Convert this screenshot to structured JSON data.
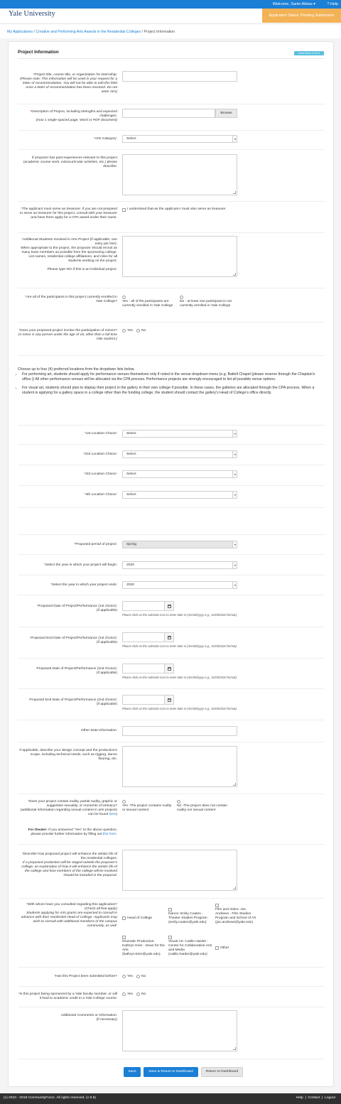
{
  "header": {
    "logo": "Yale University",
    "welcome": "Welcome, Sarim Abbas ▾",
    "help": "? Help",
    "status": "Application Status: Pending Submission"
  },
  "breadcrumb": {
    "item1": "My Applications",
    "sep": " / ",
    "item2": "Creative and Performing Arts Awards in the Residential Colleges",
    "item3": "Project Information"
  },
  "section": {
    "title": "Project Information",
    "autosave": "Auto Save in 6:13"
  },
  "fields": {
    "project_title": {
      "label": "Project title, course title, or organization for internship:",
      "note": "(Please note: This information will be used in your request for a letter of recommendation. You will not be able to edit this field once a letter of recommendation has been received. Do not enter N/A)"
    },
    "description": {
      "label": "Description of Project, including strengths and expected challenges.",
      "note": "(max 1 single-spaced page, Word or PDF document)",
      "browse": "Browse"
    },
    "arts_category": {
      "label": "Arts Category:",
      "value": "Select"
    },
    "past_experience": {
      "label": "If proposer has past experiences relevant to this project (academic course work, extracurricular activities, etc.) please describe:"
    },
    "treasurer": {
      "label": "The applicant must serve as treasurer. If you are not prepared to serve as treasurer for this project, consult with your treasurer and have them apply for a CPA award under their name.",
      "option": "I understand that-as the applicant-I must also serve as treasurer"
    },
    "additional_students": {
      "label": "Additional Students Involved in Arts Project (if applicable; one entry per line):",
      "detail": "When appropriate to the project, the proposer should recruit as many team members as possible from the sponsoring college.  List names, residential college affiliations, and roles for all students working on the project.",
      "na": "Please type N/A if this is an individual project."
    },
    "enrolled": {
      "label": "Are all of the participants in this project currently enrolled in Yale College?",
      "yes": "Yes - all of the participants are currently enrolled in Yale College",
      "no": "No - at least one participant is not currently enrolled in Yale College"
    },
    "minors": {
      "label": "Does your proposed project involve the participation of minors?",
      "note": "(A minor is any person under the age of 18, other than a full time Yale student.)",
      "yes": "Yes",
      "no": "No"
    }
  },
  "locations": {
    "intro": "Choose up to four (4) preferred locations from the dropdown lists below.",
    "bullet1": "For performing art, students should apply for performance venues themselves only if noted in the venue dropdown menu (e.g. Battell Chapel (please reserve through the Chaplain's office.)) All other performance venues will be allocated via the CPA process. Performance projects are strongly encouraged to list all possible venue options.",
    "bullet2": "For visual art, students should plan to display their project in the gallery in their own college if possible. In these cases, the galleries are allocated through the CPA process. When a student is applying for a gallery space in a college other than the funding college, the student should contact the gallery's Head of College's office directly.",
    "choice1": "1st Location Choice:",
    "choice2": "2nd Location Choice:",
    "choice3": "3rd Location Choice:",
    "choice4": "4th Location Choice:",
    "select": "Select"
  },
  "schedule": {
    "period_label": "Proposed period of project:",
    "period_value": "Spring",
    "begin_label": "Select the year in which your project will begin:",
    "begin_value": "2020",
    "end_label": "Select the year in which your project ends:",
    "end_value": "2020",
    "date1_label": "Proposed Date of Project/Performance (1st choice):",
    "end1_label": "Proposed End Date of Project/Performance (1st choice):",
    "date2_label": "Proposed Date of Project/Performance (2nd choice):",
    "end2_label": "Proposed End Date of Project/Performance (2nd choice):",
    "if_applicable": "(if applicable)",
    "date_hint": "Please click on the calendar icon to enter date in (mm/dd/yyyy e.g., 01/05/2020 format).",
    "other_label": "Other Date Information:",
    "design_label": "If applicable, describe your design concept and the production's scope, including technical needs, such as rigging, dance flooring, etc."
  },
  "nudity": {
    "label": "Does your project contain nudity, partial nudity, graphic or suggestive sexuality, or moments of intimacy?",
    "label2": "(additional information regarding sexual content in arts projects can be found ",
    "here": "here",
    "close": ")",
    "yes": "Yes -The project contains nudity or sexual content",
    "no": "No -The project does not contain nudity nor sexual content",
    "theater_bold": "For theater:",
    "theater_text": " If you answered \"Yes\" to the above question, please provide further information by filling out ",
    "this_form": "this form",
    "period": "."
  },
  "enhance": {
    "label": "Describe how proposed project will enhance the artistic life of the residential colleges:",
    "note": "If a proposed production will be staged outside the proposer's college, an explanation of how it will enhance the artistic life of the college and how members of the college will be involved should be included in the proposal."
  },
  "consulted": {
    "label": "With whom have you consulted regarding this application? (Check all that apply)",
    "note": "Students applying for Arts grants are expected to consult in advance with their residential Head of College. Applicants may wish to consult with additional members of the campus community, as well.",
    "opt_head": "Head of College",
    "opt_dance": "Dance: Emily Coates - Theater Studies Program (emily.coates@yale.edu)",
    "opt_film": "Film and Video: Jon Andrews - Film Studies Program and School of Art (jon.andrews@yale.edu)",
    "opt_drama": "Dramatic Production: Kathryn Krier - Dean for the Arts (kathryn.krier@yale.edu)",
    "opt_visual": "Visual Art: Caitlin Harder - Center for Collaborative Arts and Media (caitlin.harder@yale.edu)",
    "opt_other": "Other"
  },
  "submitted": {
    "label": "Has this Project been submitted before?",
    "yes": "Yes",
    "no": "No"
  },
  "sponsored": {
    "label": "Is this project being sponsored by a Yale faculty member, or will it lead to academic credit in a Yale College course:",
    "yes": "Yes",
    "no": "No"
  },
  "comments": {
    "label": "Additional Comments or Information:",
    "note": "(if necessary)"
  },
  "buttons": {
    "save": "Save",
    "save_return": "Save & Return to Dashboard",
    "return": "Return to Dashboard"
  },
  "footer": {
    "copyright": "(c) 2010 - 2019 CommunityForce. All rights reserved. (v 9.5)",
    "help": "Help",
    "contact": "Contact",
    "logout": "Logout"
  },
  "colors": {
    "brand": "#1b7fd6",
    "status": "#f3b256",
    "required": "#d9301a",
    "footer": "#303030",
    "autosave": "#5bc0de"
  }
}
